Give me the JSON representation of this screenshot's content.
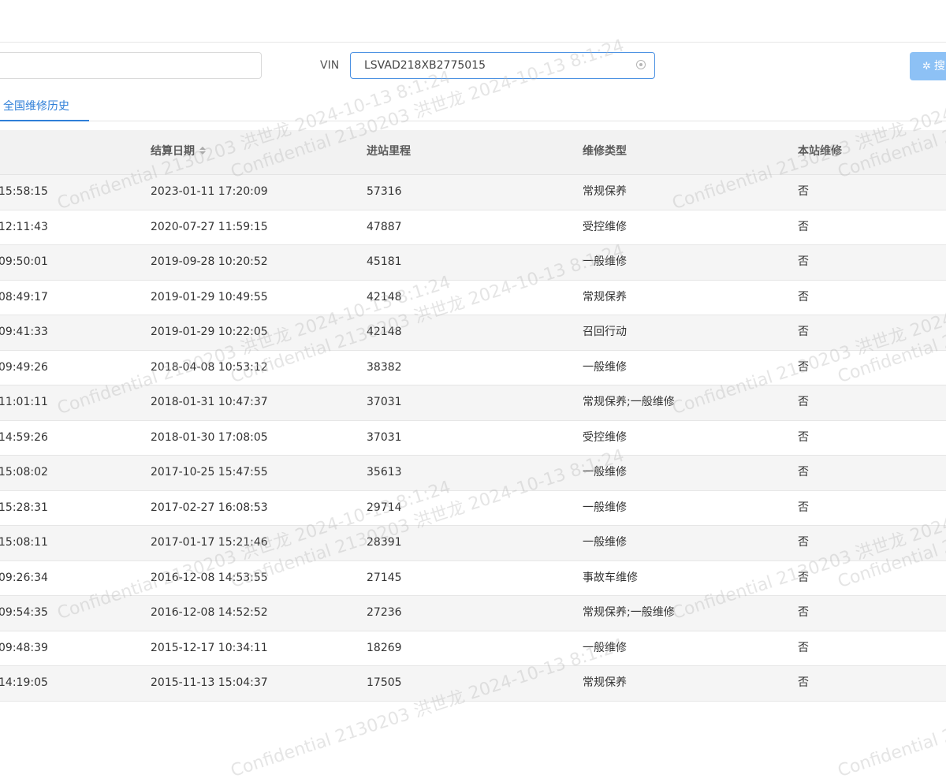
{
  "filter": {
    "vin_label": "VIN",
    "vin_value": "LSVAD218XB2775015",
    "query_button_label": "搜"
  },
  "tabs": [
    {
      "label": "全国维修历史",
      "active": true
    }
  ],
  "table": {
    "headers": [
      "结算日期",
      "进站里程",
      "维修类型",
      "本站维修"
    ],
    "rows": [
      [
        "15:58:15",
        "2023-01-11 17:20:09",
        "57316",
        "常规保养",
        "否"
      ],
      [
        "12:11:43",
        "2020-07-27 11:59:15",
        "47887",
        "受控维修",
        "否"
      ],
      [
        "09:50:01",
        "2019-09-28 10:20:52",
        "45181",
        "一般维修",
        "否"
      ],
      [
        "08:49:17",
        "2019-01-29 10:49:55",
        "42148",
        "常规保养",
        "否"
      ],
      [
        "09:41:33",
        "2019-01-29 10:22:05",
        "42148",
        "召回行动",
        "否"
      ],
      [
        "09:49:26",
        "2018-04-08 10:53:12",
        "38382",
        "一般维修",
        "否"
      ],
      [
        "11:01:11",
        "2018-01-31 10:47:37",
        "37031",
        "常规保养;一般维修",
        "否"
      ],
      [
        "14:59:26",
        "2018-01-30 17:08:05",
        "37031",
        "受控维修",
        "否"
      ],
      [
        "15:08:02",
        "2017-10-25 15:47:55",
        "35613",
        "一般维修",
        "否"
      ],
      [
        "15:28:31",
        "2017-02-27 16:08:53",
        "29714",
        "一般维修",
        "否"
      ],
      [
        "15:08:11",
        "2017-01-17 15:21:46",
        "28391",
        "一般维修",
        "否"
      ],
      [
        "09:26:34",
        "2016-12-08 14:53:55",
        "27145",
        "事故车维修",
        "否"
      ],
      [
        "09:54:35",
        "2016-12-08 14:52:52",
        "27236",
        "常规保养;一般维修",
        "否"
      ],
      [
        "09:48:39",
        "2015-12-17 10:34:11",
        "18269",
        "一般维修",
        "否"
      ],
      [
        "14:19:05",
        "2015-11-13 15:04:37",
        "17505",
        "常规保养",
        "否"
      ]
    ]
  },
  "watermarks": [
    "Confidential 2130203 洪世龙 2024-10-13 8:1:24"
  ],
  "colors": {
    "accent": "#2f7fd8",
    "button_bg": "#8dc1f5",
    "header_bg": "#f2f2f2",
    "row_alt_bg": "#f5f5f5"
  }
}
